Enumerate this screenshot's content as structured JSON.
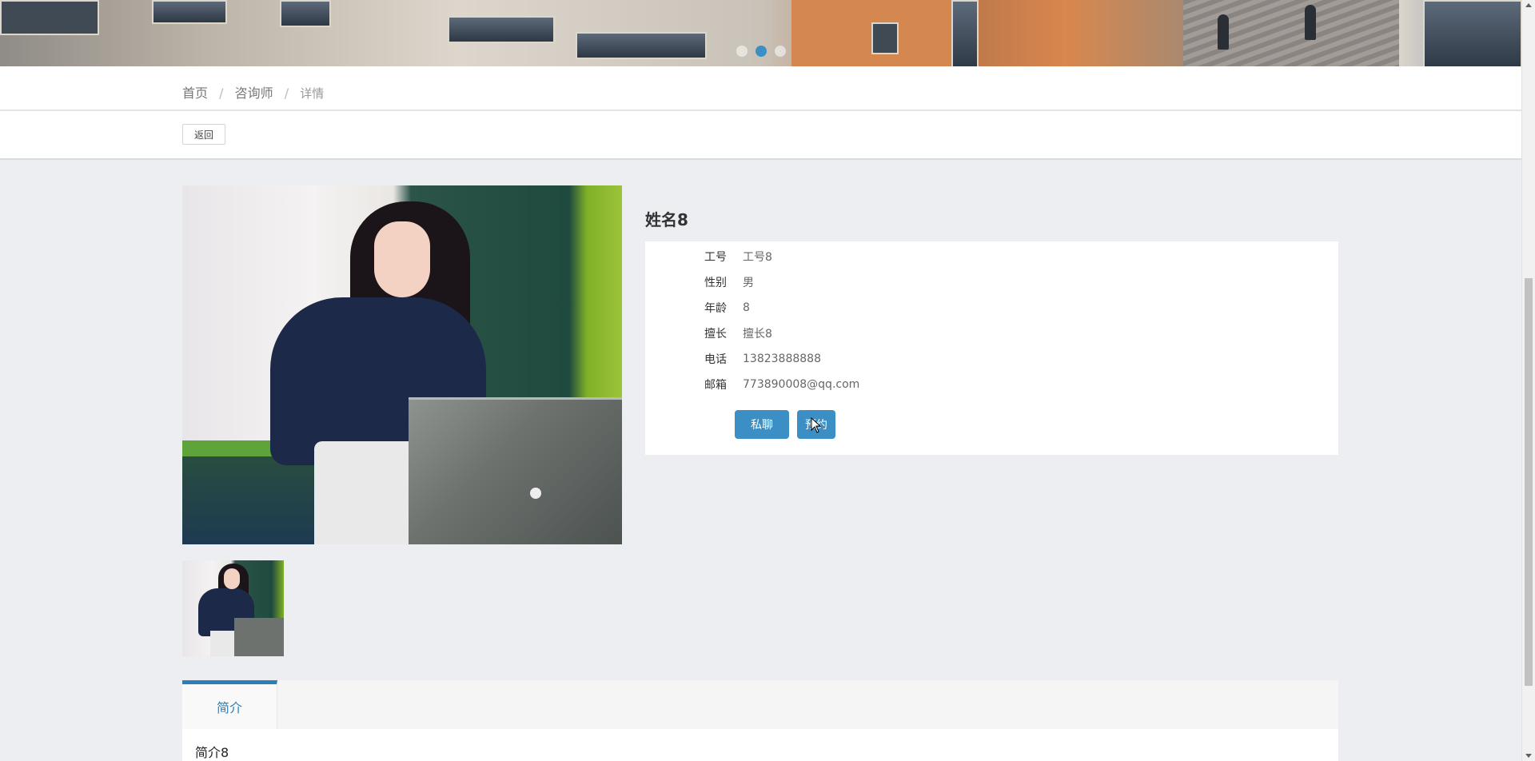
{
  "banner": {
    "slide_indicators": [
      {
        "name": "slide-dot-1",
        "active": false
      },
      {
        "name": "slide-dot-2",
        "active": true
      },
      {
        "name": "slide-dot-3",
        "active": false
      }
    ]
  },
  "breadcrumb": {
    "home": "首页",
    "section": "咨询师",
    "current": "详情",
    "separator": "/"
  },
  "back_button": "返回",
  "counselor": {
    "name": "姓名8",
    "fields": [
      {
        "label": "工号",
        "value": "工号8"
      },
      {
        "label": "性别",
        "value": "男"
      },
      {
        "label": "年龄",
        "value": "8"
      },
      {
        "label": "擅长",
        "value": "擅长8"
      },
      {
        "label": "电话",
        "value": "13823888888"
      },
      {
        "label": "邮箱",
        "value": "773890008@qq.com"
      }
    ],
    "actions": {
      "chat": "私聊",
      "book": "预约"
    }
  },
  "tabs": {
    "items": [
      {
        "label": "简介",
        "active": true
      }
    ],
    "content": "简介8"
  },
  "colors": {
    "accent": "#3b8fc4",
    "page_bg": "#eceef1"
  }
}
